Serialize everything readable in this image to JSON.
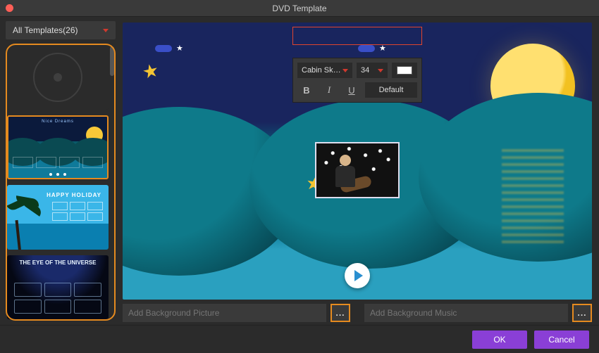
{
  "window": {
    "title": "DVD Template"
  },
  "sidebar": {
    "dropdown_label": "All Templates(26)",
    "templates": [
      {
        "kind": "disc"
      },
      {
        "kind": "dreams",
        "title": "Nice Dreams",
        "selected": true
      },
      {
        "kind": "holiday",
        "title": "HAPPY HOLIDAY"
      },
      {
        "kind": "universe",
        "title": "THE EYE OF THE UNIVERSE"
      }
    ]
  },
  "text_toolbar": {
    "font_label": "Cabin Sk…",
    "size_label": "34",
    "bold": "B",
    "italic": "I",
    "underline": "U",
    "default_label": "Default",
    "color": "#ffffff"
  },
  "bg_picture": {
    "placeholder": "Add Background Picture",
    "browse": "..."
  },
  "bg_music": {
    "placeholder": "Add Background Music",
    "browse": "..."
  },
  "buttons": {
    "ok": "OK",
    "cancel": "Cancel"
  }
}
